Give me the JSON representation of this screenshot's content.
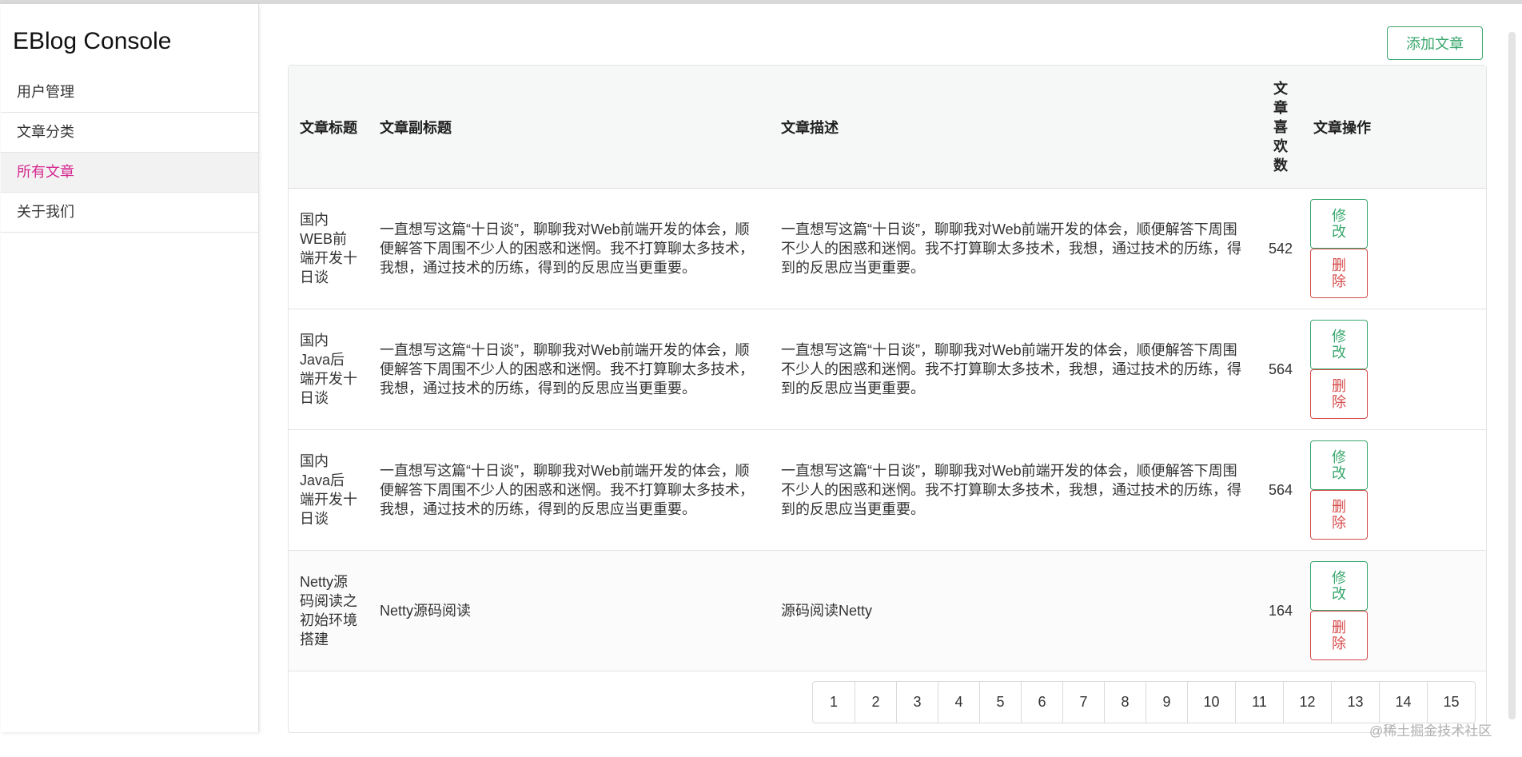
{
  "app": {
    "brand": "EBlog Console"
  },
  "sidebar": {
    "items": [
      {
        "label": "用户管理"
      },
      {
        "label": "文章分类"
      },
      {
        "label": "所有文章",
        "active": true
      },
      {
        "label": "关于我们"
      }
    ]
  },
  "toolbar": {
    "add_label": "添加文章"
  },
  "table": {
    "headers": {
      "title": "文章标题",
      "subtitle": "文章副标题",
      "description": "文章描述",
      "likes": "文章喜欢数",
      "actions": "文章操作"
    },
    "rows": [
      {
        "title": "国内WEB前端开发十日谈",
        "subtitle": "一直想写这篇“十日谈”，聊聊我对Web前端开发的体会，顺便解答下周围不少人的困惑和迷惘。我不打算聊太多技术，我想，通过技术的历练，得到的反思应当更重要。",
        "description": "一直想写这篇“十日谈”，聊聊我对Web前端开发的体会，顺便解答下周围不少人的困惑和迷惘。我不打算聊太多技术，我想，通过技术的历练，得到的反思应当更重要。",
        "likes": "542"
      },
      {
        "title": "国内Java后端开发十日谈",
        "subtitle": "一直想写这篇“十日谈”，聊聊我对Web前端开发的体会，顺便解答下周围不少人的困惑和迷惘。我不打算聊太多技术，我想，通过技术的历练，得到的反思应当更重要。",
        "description": "一直想写这篇“十日谈”，聊聊我对Web前端开发的体会，顺便解答下周围不少人的困惑和迷惘。我不打算聊太多技术，我想，通过技术的历练，得到的反思应当更重要。",
        "likes": "564"
      },
      {
        "title": "国内Java后端开发十日谈",
        "subtitle": "一直想写这篇“十日谈”，聊聊我对Web前端开发的体会，顺便解答下周围不少人的困惑和迷惘。我不打算聊太多技术，我想，通过技术的历练，得到的反思应当更重要。",
        "description": "一直想写这篇“十日谈”，聊聊我对Web前端开发的体会，顺便解答下周围不少人的困惑和迷惘。我不打算聊太多技术，我想，通过技术的历练，得到的反思应当更重要。",
        "likes": "564"
      },
      {
        "title": "Netty源码阅读之初始环境搭建",
        "subtitle": "Netty源码阅读",
        "description": "源码阅读Netty",
        "likes": "164"
      }
    ],
    "edit_label": "修改",
    "delete_label": "删除"
  },
  "pagination": {
    "pages": [
      "1",
      "2",
      "3",
      "4",
      "5",
      "6",
      "7",
      "8",
      "9",
      "10",
      "11",
      "12",
      "13",
      "14",
      "15"
    ]
  },
  "watermark": "@稀土掘金技术社区",
  "colors": {
    "accent_pink": "#d6278f",
    "edit_green": "#3aa76d",
    "delete_red": "#d54a4a"
  }
}
